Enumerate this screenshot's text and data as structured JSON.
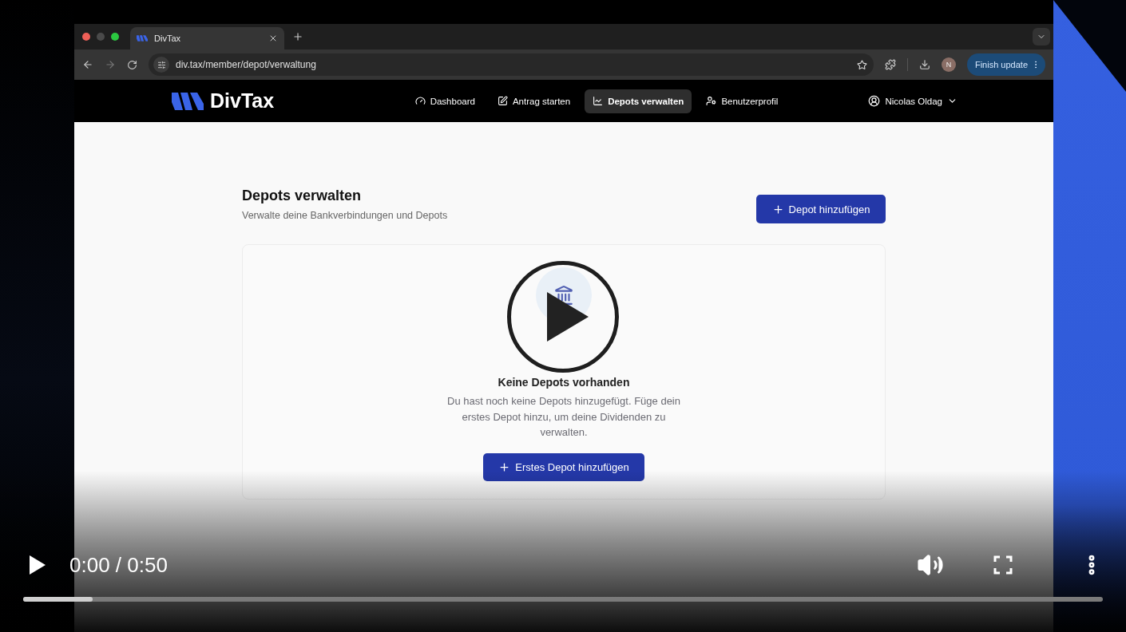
{
  "browser": {
    "tab_title": "DivTax",
    "url": "div.tax/member/depot/verwaltung",
    "profile_initial": "N",
    "update_button": "Finish update"
  },
  "app_nav": {
    "brand": "DivTax",
    "items": [
      {
        "label": "Dashboard",
        "kind": "gauge",
        "selected": false
      },
      {
        "label": "Antrag starten",
        "kind": "edit",
        "selected": false
      },
      {
        "label": "Depots verwalten",
        "kind": "chart",
        "selected": true
      },
      {
        "label": "Benutzerprofil",
        "kind": "user-gear",
        "selected": false
      }
    ],
    "user": "Nicolas Oldag"
  },
  "page": {
    "title": "Depots verwalten",
    "subtitle": "Verwalte deine Bankverbindungen und Depots",
    "add_button": "Depot hinzufügen",
    "empty_state": {
      "title": "Keine Depots vorhanden",
      "text": "Du hast noch keine Depots hinzugefügt. Füge dein erstes Depot hinzu, um deine Dividenden zu verwalten.",
      "button": "Erstes Depot hinzufügen"
    }
  },
  "player": {
    "time": "0:00 / 0:50",
    "progress": {
      "level": 0.064
    }
  }
}
